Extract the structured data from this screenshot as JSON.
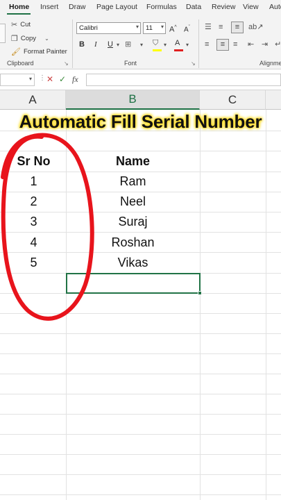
{
  "ribbon_tabs": [
    "Home",
    "Insert",
    "Draw",
    "Page Layout",
    "Formulas",
    "Data",
    "Review",
    "View",
    "Auto"
  ],
  "clipboard": {
    "cut_label": "Cut",
    "copy_label": "Copy",
    "format_painter_label": "Format Painter",
    "group_label": "Clipboard"
  },
  "font": {
    "family": "Calibri",
    "size": "11",
    "group_label": "Font",
    "bold": "B",
    "italic": "I",
    "underline": "U",
    "grow": "A",
    "shrink": "A",
    "color_letter": "A",
    "fill_color": "#ffff00",
    "font_color": "#e02020"
  },
  "alignment": {
    "group_label": "Alignme"
  },
  "formula_bar": {
    "fx_label": "fx",
    "value": ""
  },
  "columns": [
    "A",
    "B",
    "C"
  ],
  "banner": {
    "text": "Automatic Fill Serial Number",
    "glow_color": "#ffe033"
  },
  "table": {
    "headers": [
      "Sr No",
      "Name"
    ],
    "rows": [
      [
        "1",
        "Ram"
      ],
      [
        "2",
        "Neel"
      ],
      [
        "3",
        "Suraj"
      ],
      [
        "4",
        "Roshan"
      ],
      [
        "5",
        "Vikas"
      ]
    ]
  },
  "colors": {
    "accent": "#217346",
    "annotation_circle": "#e8141c"
  }
}
